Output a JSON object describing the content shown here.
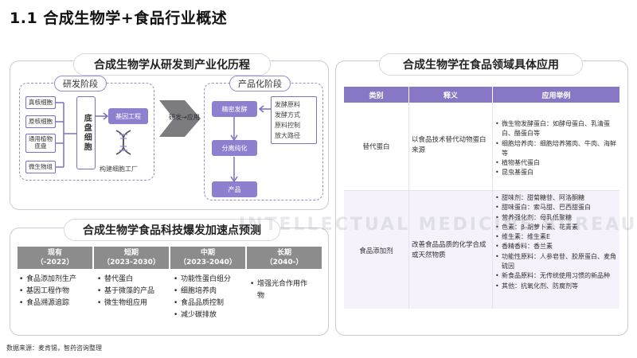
{
  "page_title": "1.1 合成生物学+食品行业概述",
  "left_top": {
    "heading": "合成生物学从研发到产业化历程",
    "rd_stage": {
      "label": "研发阶段",
      "cells": [
        "真核细胞",
        "原核细胞",
        "通用植物底盘",
        "微生物组"
      ],
      "chassis": "底盘细胞",
      "gene": "基因工程",
      "factory": "构建细胞工厂"
    },
    "arrow_label": "研发→应用",
    "product_stage": {
      "label": "产品化阶段",
      "steps": [
        "精密发酵",
        "分离纯化",
        "产品"
      ],
      "notes": [
        "发酵原料",
        "发酵方式",
        "原料控制",
        "放大路径"
      ]
    }
  },
  "left_bottom": {
    "heading": "合成生物学食品科技爆发加速点预测",
    "columns": [
      {
        "title": "现有",
        "period": "（-2022）",
        "items": [
          "食品添加剂生产",
          "基因工程作物",
          "食品溯源追踪"
        ]
      },
      {
        "title": "短期",
        "period": "（2023-2030）",
        "items": [
          "替代蛋白",
          "基于微藻的产品",
          "微生物组应用"
        ]
      },
      {
        "title": "中期",
        "period": "（2023-2040）",
        "items": [
          "功能性蛋白组分",
          "细胞培养肉",
          "食品品质控制",
          "减少碳排放"
        ]
      },
      {
        "title": "长期",
        "period": "（2040-）",
        "items": [
          "增强光合作用作物"
        ]
      }
    ]
  },
  "right": {
    "heading": "合成生物学在食品领域具体应用",
    "headers": [
      "类别",
      "释义",
      "应用举例"
    ],
    "rows": [
      {
        "category": "替代蛋白",
        "definition": "以食品技术替代动物蛋白来源",
        "examples": [
          "微生物发酵蛋白：如酵母蛋白、乳清蛋白、酪蛋白等",
          "细胞培养肉：细胞培养猪肉、牛肉、海鲜等",
          "植物基代蛋白",
          "昆虫基蛋白"
        ]
      },
      {
        "category": "食品添加剂",
        "definition": "改善食品品质的化学合成或天然物质",
        "examples": [
          "甜味剂：甜菊糖苷、阿洛酮糖",
          "甜味蛋白：索马甜、巴西甜蛋白",
          "营养强化剂：母乳低聚糖",
          "色素：β-胡萝卜素、花青素",
          "维生素：维生素E",
          "香精香料：香兰素",
          "功能性原料：人参皂苷、胶原蛋白、麦角硫因",
          "新食品原料：无传统使用习惯的新品种",
          "其他：抗氧化剂、防腐剂等"
        ]
      }
    ]
  },
  "watermark": "INTELLECTUAL MEDICINE BUREAU",
  "source": "数据来源：麦肯锡，智药咨询整理"
}
